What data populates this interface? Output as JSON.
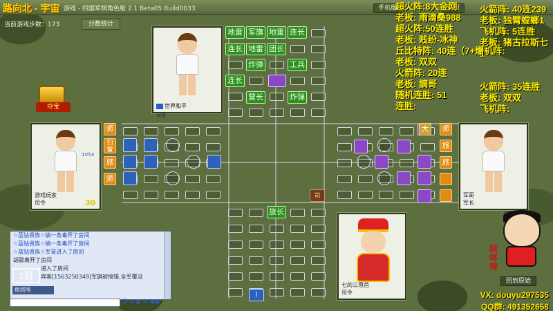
{
  "topbar": {
    "title": "路向北 - 宇宙",
    "subtitle": "游戏 - 四国军棋角色版 2.1 Beta05 Build0033",
    "buttons": [
      "手机版",
      "设置"
    ]
  },
  "game_info": {
    "steps_label": "当前游戏步数：173",
    "stats_button": "分数统计"
  },
  "treasure": {
    "label": "夺宝"
  },
  "players": {
    "top": {
      "name": "世界和平",
      "rank": "司令"
    },
    "left": {
      "name": "游戏玩家",
      "rank": "司令",
      "score": "30",
      "level_badge": "1V53"
    },
    "right": {
      "name": "军哥",
      "rank": "军长"
    },
    "bottom": {
      "name": "七的三用首",
      "rank": "司令"
    }
  },
  "top_pieces": [
    {
      "label": "地雷"
    },
    {
      "label": "军旗"
    },
    {
      "label": "地雷"
    },
    {
      "label": "连长"
    },
    {
      "label": "连长"
    },
    {
      "label": "地雷"
    },
    {
      "label": "团长"
    },
    {
      "label": "炸弹"
    },
    {
      "label": "工兵"
    },
    {
      "label": "连长"
    },
    {
      "label": "营长"
    },
    {
      "label": "炸弹"
    }
  ],
  "left_pieces": [
    "师",
    "扫雷",
    "旅",
    "师"
  ],
  "right_pieces": [
    "大",
    "师",
    "旅",
    "旅"
  ],
  "board_marks": {
    "center": "司",
    "bottom_piece": "旅长",
    "bottom_flag": "!"
  },
  "overlay_left": [
    "超火阵:8大金刚",
    "老板: 雨滴桑988",
    "超火阵:50连胜",
    "老板: 贱纷-冰神",
    "丘比特阵: 40连（7+爆机阵:",
    "老板: 双双",
    "火箭阵: 20连",
    "老板: 謫哥",
    "随机连胜: 51",
    "连胜:"
  ],
  "overlay_right": [
    "火箭阵: 40连239",
    "老板: 独臂螳螂1",
    "飞机阵: 5连胜",
    "老板: 猪古拉斯七1",
    "",
    "",
    "火箭阵: 35连胜",
    "老板: 双双",
    "飞机阵:"
  ],
  "chat": {
    "lines": [
      "☆蓝钻贵族☆搞一条毒开了房间",
      "☆蓝钻贵族☆搞一条毒开了房间",
      "☆蓝钻贵族☆军哥进入了房间",
      "胡歌离开了房间",
      "进入了房间",
      "宾客[1563250349]军旗被搞错,全军覆没"
    ],
    "room_label": "房间号",
    "logo": "1目",
    "icons": "☺✉◐✈◀▶"
  },
  "contact": {
    "vx": "VX: douyu297535",
    "qq": "QQ群: 491352658"
  },
  "mascot": {
    "text": "骑咩辣",
    "button": "回到原始"
  },
  "colors": {
    "accent": "#ffee00",
    "board_line": "#d8e0ee"
  }
}
